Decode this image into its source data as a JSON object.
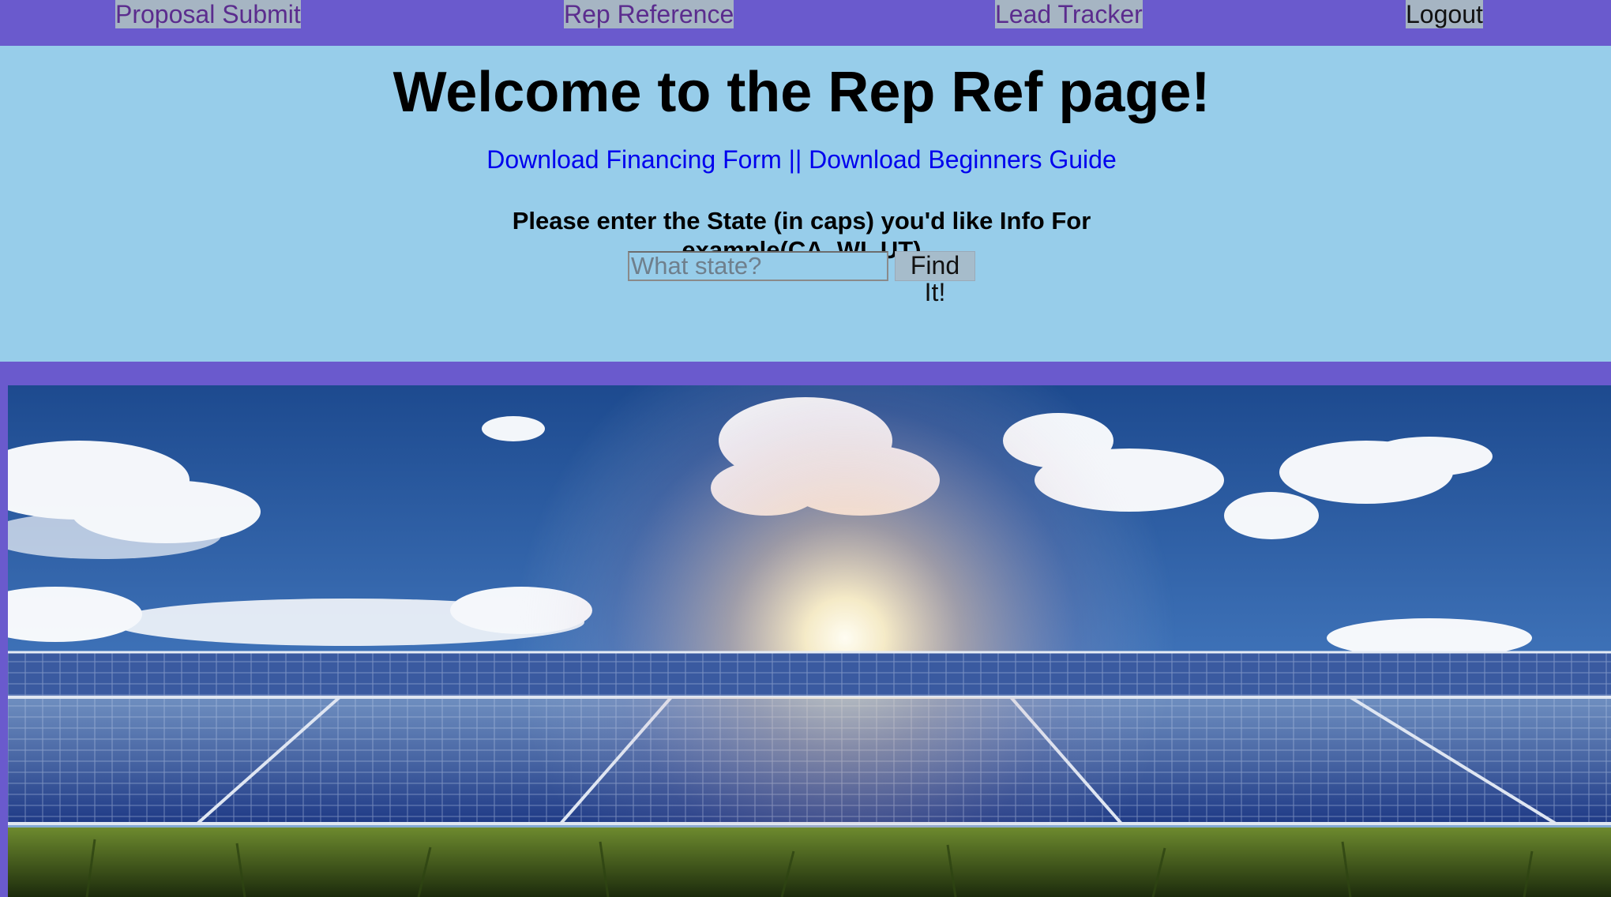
{
  "nav": {
    "items": [
      {
        "label": "Proposal Submit"
      },
      {
        "label": "Rep Reference"
      },
      {
        "label": "Lead Tracker"
      },
      {
        "label": "Logout"
      }
    ]
  },
  "main": {
    "title": "Welcome to the Rep Ref page!",
    "link_financing": "Download Financing Form",
    "link_separator": " || ",
    "link_guide": "Download Beginners Guide",
    "prompt": "Please enter the State (in caps) you'd like Info For example(CA, WI, UT)"
  },
  "search": {
    "placeholder": "What state?",
    "value": "",
    "button_label": "Find It!"
  },
  "colors": {
    "nav_bg": "#6a5acd",
    "hero_bg": "#97cdea",
    "link": "#0000ee",
    "nav_visited": "#5b2c8e"
  },
  "image": {
    "alt": "solar-panels-under-sun"
  }
}
